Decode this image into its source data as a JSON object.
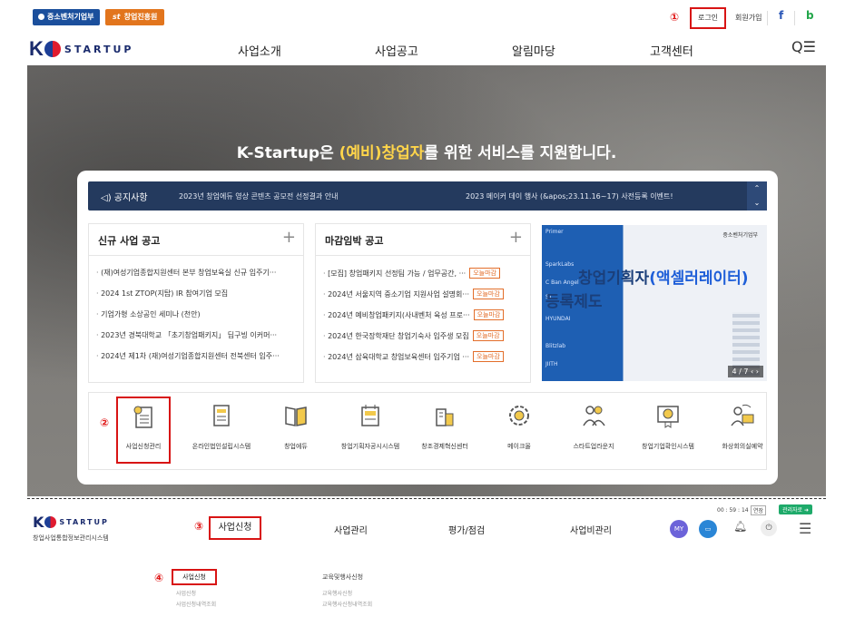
{
  "topbar": {
    "gov_label": "중소벤처기업부",
    "kised_label": "창업진흥원",
    "kised_prefix": "st",
    "marker1": "①",
    "login_label": "로그인",
    "signup_label": "회원가입",
    "facebook_icon": "f",
    "blog_icon": "b"
  },
  "nav": {
    "logo_k": "K",
    "logo_word": "STARTUP",
    "items": [
      "사업소개",
      "사업공고",
      "알림마당",
      "고객센터"
    ],
    "search_menu_icon": "Q☰"
  },
  "hero": {
    "title_pre": "K-Startup은 ",
    "title_highlight": "(예비)창업자",
    "title_post": "를 위한 서비스를 지원합니다."
  },
  "notice": {
    "label": "공지사항",
    "icon": "speaker-icon",
    "items": [
      "2023년 창업에듀 영상 콘텐츠 공모전 선정결과 안내",
      "2023 메이커 데이 행사 (&apos;23.11.16~17) 사전등록 이벤트!"
    ]
  },
  "panel_new": {
    "title": "신규 사업 공고",
    "items": [
      "(재)여성기업종합지원센터 본부 창업보육실 신규 입주기···",
      "2024 1st ZTOP(지탑) IR 참여기업 모집",
      "기업가형 소상공인 세미나 (천안)",
      "2023년 경북대학교 「초기창업패키지」 딥구빙 이커머···",
      "2024년 제1차 (재)여성기업종합지원센터 전북센터 입주···"
    ]
  },
  "panel_deadline": {
    "title": "마감임박 공고",
    "tag": "오늘마감",
    "items": [
      "[모집] 창업패키지 선정팀 가능 / 업무공간, ···",
      "2024년 서울지역 중소기업 지원사업 설명회···",
      "2024년 예비창업패키지(사내벤처 육성 프로···",
      "2024년 한국장학재단 창업기숙사 입주생 모집",
      "2024년 삼육대학교 창업보육센터 입주기업 ···"
    ]
  },
  "banner": {
    "ministry": "중소벤처기업부",
    "line1_pre": "창업기획자",
    "line1_acc": "(액셀러레이터)",
    "line2": "등록제도",
    "pager": "4 / 7",
    "strip": [
      "Primer",
      "SparkLabs",
      "C Ban Angel",
      "ST",
      "HYUNDAI",
      "Blitzlab",
      "JIITH"
    ]
  },
  "quick": {
    "marker2": "②",
    "items": [
      {
        "label": "사업신청관리",
        "icon": "application-doc-icon"
      },
      {
        "label": "온라인법인설립시스템",
        "icon": "building-doc-icon"
      },
      {
        "label": "창업에듀",
        "icon": "book-icon"
      },
      {
        "label": "창업기획자공시시스템",
        "icon": "notebook-icon"
      },
      {
        "label": "창조경제혁신센터",
        "icon": "city-icon"
      },
      {
        "label": "메이크올",
        "icon": "gear-icon"
      },
      {
        "label": "스타트업라운지",
        "icon": "people-icon"
      },
      {
        "label": "창업기업확인시스템",
        "icon": "certificate-icon"
      },
      {
        "label": "화상회의실예약",
        "icon": "video-meeting-icon"
      }
    ]
  },
  "lower": {
    "logo_k": "K",
    "logo_word": "STARTUP",
    "subtitle": "창업사업통합정보관리시스템",
    "marker3": "③",
    "menu": [
      "사업신청",
      "사업관리",
      "평가/점검",
      "사업비관리"
    ],
    "timer": "00 : 59 : 14",
    "extend": "연장",
    "manager": "관리자로 ➜",
    "my": "MY",
    "marker4": "④",
    "sub_selected": "사업신청",
    "sub_left_items": [
      "사업신청",
      "사업신청내역조회"
    ],
    "sub_right_head": "교육및행사신청",
    "sub_right_items": [
      "교육행사신청",
      "교육행사신청내역조회"
    ]
  }
}
